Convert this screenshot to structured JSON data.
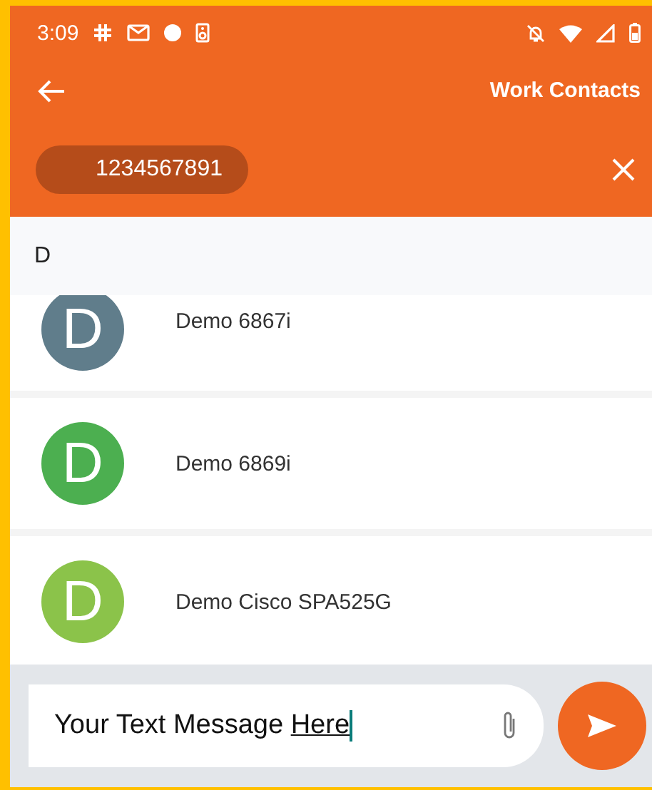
{
  "status_bar": {
    "time": "3:09"
  },
  "app_bar": {
    "title": "Work Contacts"
  },
  "recipient_chip": {
    "label": "1234567891"
  },
  "section": {
    "header": "D"
  },
  "contacts": [
    {
      "initial": "D",
      "name": "Demo 6867i",
      "color": "#607d8b"
    },
    {
      "initial": "D",
      "name": "Demo 6869i",
      "color": "#4caf50"
    },
    {
      "initial": "D",
      "name": "Demo Cisco SPA525G",
      "color": "#8bc34a"
    }
  ],
  "composer": {
    "value": "Your Text Message Here"
  }
}
